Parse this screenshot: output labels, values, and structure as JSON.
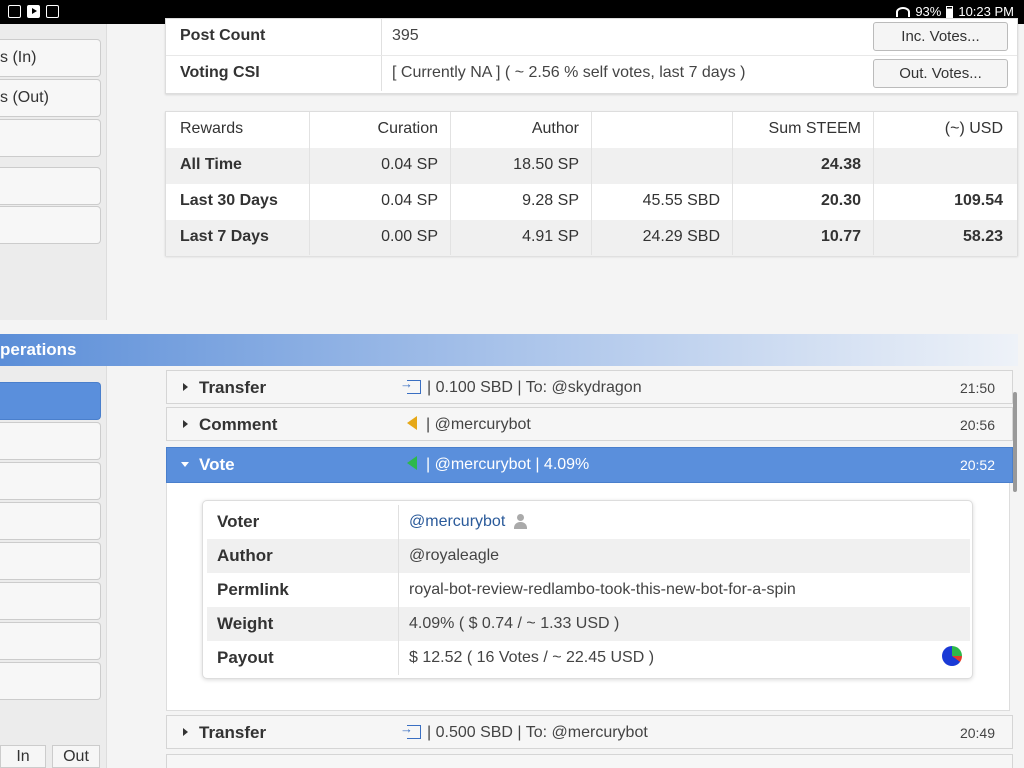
{
  "status_bar": {
    "battery": "93%",
    "time": "10:23 PM",
    "icons": [
      "image-icon",
      "youtube-icon",
      "download-icon",
      "wifi-icon",
      "battery-icon"
    ]
  },
  "sidebar": {
    "top_items": [
      {
        "label": "s (In)"
      },
      {
        "label": "s (Out)"
      },
      {
        "label": ""
      },
      {
        "label": ""
      },
      {
        "label": ""
      }
    ],
    "bottom_items": [
      {
        "label": "",
        "active": true
      },
      {
        "label": ""
      },
      {
        "label": ""
      },
      {
        "label": ""
      },
      {
        "label": ""
      },
      {
        "label": ""
      },
      {
        "label": ""
      },
      {
        "label": ""
      }
    ],
    "tabs": {
      "in": "In",
      "out": "Out"
    }
  },
  "info": {
    "post_count_label": "Post Count",
    "post_count_value": "395",
    "voting_csi_label": "Voting CSI",
    "voting_csi_value": "[ Currently NA ] ( ~ 2.56 % self votes, last 7 days )",
    "inc_votes_button": "Inc. Votes...",
    "out_votes_button": "Out. Votes..."
  },
  "rewards": {
    "headers": [
      "Rewards",
      "Curation",
      "Author",
      "",
      "Sum STEEM",
      "(~) USD"
    ],
    "rows": [
      {
        "label": "All Time",
        "curation": "0.04 SP",
        "author": "18.50 SP",
        "sbd": "",
        "sum": "24.38",
        "usd": ""
      },
      {
        "label": "Last 30 Days",
        "curation": "0.04 SP",
        "author": "9.28 SP",
        "sbd": "45.55 SBD",
        "sum": "20.30",
        "usd": "109.54"
      },
      {
        "label": "Last 7 Days",
        "curation": "0.00 SP",
        "author": "4.91 SP",
        "sbd": "24.29 SBD",
        "sum": "10.77",
        "usd": "58.23"
      }
    ]
  },
  "operations": {
    "section_title": "perations",
    "items": [
      {
        "type": "Transfer",
        "desc": "| 0.100 SBD | To: @skydragon",
        "time": "21:50",
        "icon": "transfer-icon"
      },
      {
        "type": "Comment",
        "desc": "| @mercurybot",
        "time": "20:56",
        "icon": "comment-icon"
      },
      {
        "type": "Vote",
        "desc": "| @mercurybot | 4.09%",
        "time": "20:52",
        "icon": "vote-icon",
        "active": true
      },
      {
        "type": "Transfer",
        "desc": "| 0.500 SBD | To: @mercurybot",
        "time": "20:49",
        "icon": "transfer-icon"
      }
    ],
    "vote_detail": {
      "voter_label": "Voter",
      "voter_value": "@mercurybot",
      "author_label": "Author",
      "author_value": "@royaleagle",
      "permlink_label": "Permlink",
      "permlink_value": "royal-bot-review-redlambo-took-this-new-bot-for-a-spin",
      "weight_label": "Weight",
      "weight_value": "4.09% ( $ 0.74 / ~ 1.33 USD )",
      "payout_label": "Payout",
      "payout_value": "$ 12.52 ( 16 Votes / ~ 22.45 USD )"
    }
  },
  "colors": {
    "accent_blue": "#5a8fdc",
    "link_blue": "#2a5a9a",
    "vote_green": "#2db84a",
    "comment_yellow": "#e6a817"
  }
}
